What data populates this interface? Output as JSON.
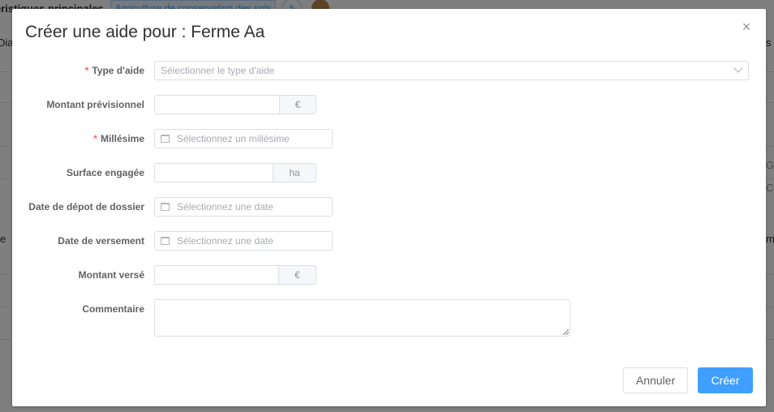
{
  "background": {
    "header_title": "éristiques principales",
    "tag_label": "Agriculture de conservation des sols",
    "left_edge_texts": [
      "Diag",
      "e"
    ],
    "right_edge_texts": [
      "s",
      "Ge",
      "Cl",
      "m"
    ]
  },
  "dialog": {
    "title": "Créer une aide pour : Ferme Aa",
    "fields": {
      "type_aide": {
        "label": "Type d'aide",
        "required": true,
        "placeholder": "Sélectionner le type d'aide"
      },
      "montant_previsionnel": {
        "label": "Montant prévisionnel",
        "unit": "€"
      },
      "millesime": {
        "label": "Millésime",
        "required": true,
        "placeholder": "Sélectionnez un millésime"
      },
      "surface_engagee": {
        "label": "Surface engagée",
        "unit": "ha"
      },
      "date_depot": {
        "label": "Date de dépot de dossier",
        "placeholder": "Sélectionnez une date"
      },
      "date_versement": {
        "label": "Date de versement",
        "placeholder": "Sélectionnez une date"
      },
      "montant_verse": {
        "label": "Montant versé",
        "unit": "€"
      },
      "commentaire": {
        "label": "Commentaire"
      }
    },
    "buttons": {
      "cancel": "Annuler",
      "create": "Créer"
    },
    "required_marker": "*",
    "close_glyph": "×"
  },
  "colors": {
    "primary": "#409eff",
    "required": "#f56c6c",
    "border": "#dcdfe6",
    "overlay": "rgba(0,0,0,0.5)"
  }
}
